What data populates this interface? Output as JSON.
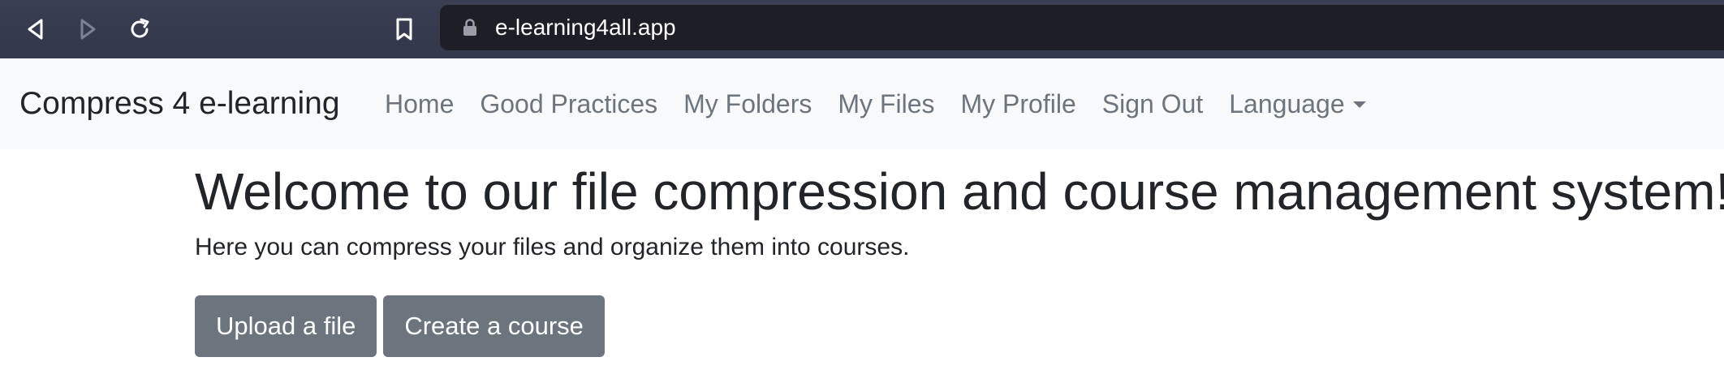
{
  "browser": {
    "url": "e-learning4all.app",
    "icons": [
      "back-icon",
      "forward-icon",
      "reload-icon",
      "bookmark-icon",
      "lock-icon"
    ]
  },
  "navbar": {
    "brand": "Compress 4 e-learning",
    "links": [
      "Home",
      "Good Practices",
      "My Folders",
      "My Files",
      "My Profile",
      "Sign Out"
    ],
    "language": "Language"
  },
  "main": {
    "title": "Welcome to our file compression and course management system!",
    "lead": "Here you can compress your files and organize them into courses.",
    "buttons": {
      "upload": "Upload a file",
      "create_course": "Create a course"
    }
  },
  "colors": {
    "chrome_bg": "#363a4f",
    "url_bar_bg": "#1d1e26",
    "navbar_bg": "#f8f9fa",
    "link": "#6c757d",
    "button_bg": "#6c757d",
    "text": "#212529"
  }
}
